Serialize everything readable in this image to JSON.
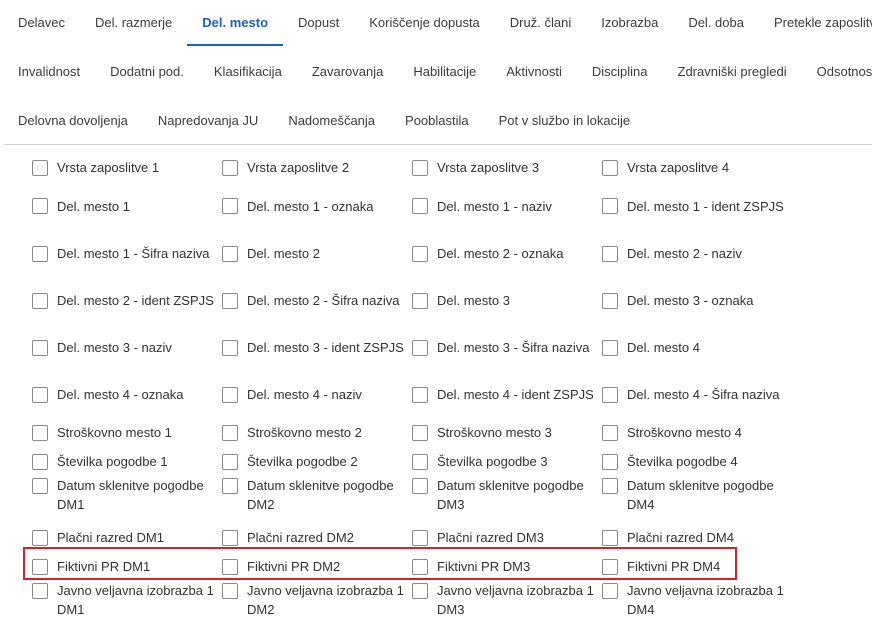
{
  "tabs": {
    "row1": [
      "Delavec",
      "Del. razmerje",
      "Del. mesto",
      "Dopust",
      "Koriščenje dopusta",
      "Druž. člani",
      "Izobrazba",
      "Del. doba",
      "Pretekle zaposlitve"
    ],
    "row2": [
      "Invalidnost",
      "Dodatni pod.",
      "Klasifikacija",
      "Zavarovanja",
      "Habilitacije",
      "Aktivnosti",
      "Disciplina",
      "Zdravniški pregledi",
      "Odsotnosti"
    ],
    "row3": [
      "Delovna dovoljenja",
      "Napredovanja JU",
      "Nadomeščanja",
      "Pooblastila",
      "Pot v službo in lokacije"
    ],
    "active": "Del. mesto"
  },
  "fields": [
    "Vrsta zaposlitve 1",
    "Vrsta zaposlitve 2",
    "Vrsta zaposlitve 3",
    "Vrsta zaposlitve 4",
    "Del. mesto 1",
    "Del. mesto 1 - oznaka",
    "Del. mesto 1 - naziv",
    "Del. mesto 1 - ident ZSPJS",
    "Del. mesto 1 - Šifra naziva",
    "Del. mesto 2",
    "Del. mesto 2 - oznaka",
    "Del. mesto 2 - naziv",
    "Del. mesto 2 - ident ZSPJS",
    "Del. mesto 2 - Šifra naziva",
    "Del. mesto 3",
    "Del. mesto 3 - oznaka",
    "Del. mesto 3 - naziv",
    "Del. mesto 3 - ident ZSPJS",
    "Del. mesto 3 - Šifra naziva",
    "Del. mesto 4",
    "Del. mesto 4 - oznaka",
    "Del. mesto 4 - naziv",
    "Del. mesto 4 - ident ZSPJS",
    "Del. mesto 4 - Šifra naziva",
    "Stroškovno mesto 1",
    "Stroškovno mesto 2",
    "Stroškovno mesto 3",
    "Stroškovno mesto 4",
    "Številka pogodbe 1",
    "Številka pogodbe 2",
    "Številka pogodbe 3",
    "Številka pogodbe 4",
    "Datum sklenitve pogodbe DM1",
    "Datum sklenitve pogodbe DM2",
    "Datum sklenitve pogodbe DM3",
    "Datum sklenitve pogodbe DM4",
    "Plačni razred DM1",
    "Plačni razred DM2",
    "Plačni razred DM3",
    "Plačni razred DM4",
    "Fiktivni PR DM1",
    "Fiktivni PR DM2",
    "Fiktivni PR DM3",
    "Fiktivni PR DM4",
    "Javno veljavna izobrazba 1 DM1",
    "Javno veljavna izobrazba 1 DM2",
    "Javno veljavna izobrazba 1 DM3",
    "Javno veljavna izobrazba 1 DM4"
  ],
  "highlight_color": "#d9202e",
  "accent_color": "#1565c0"
}
